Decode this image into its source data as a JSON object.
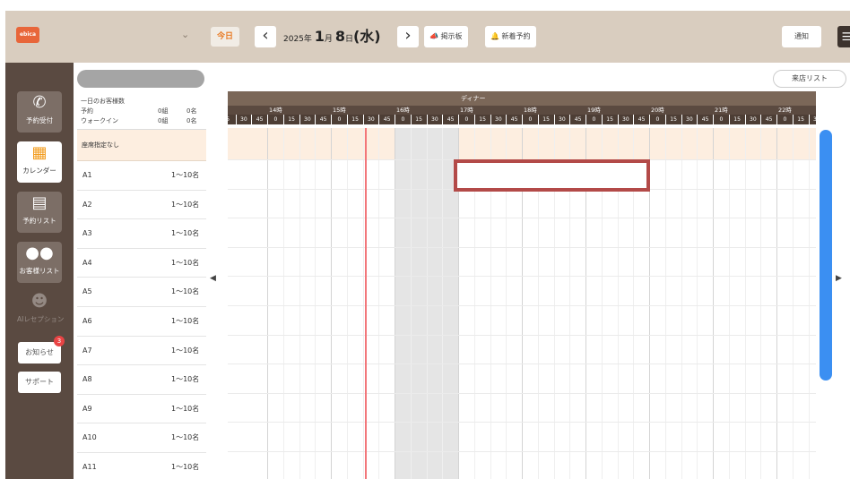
{
  "header": {
    "logo_text": "ebica",
    "today_label": "今日",
    "prev_icon": "chevron-left-icon",
    "next_icon": "chevron-right-icon",
    "date": {
      "year_label": "2025年",
      "month": "1",
      "month_unit": "月",
      "day": "8",
      "day_unit": "日",
      "weekday": "(水)"
    },
    "board_label": "掲示板",
    "new_reservation_label": "新着予約",
    "notify_label": "通知",
    "menu_icon": "hamburger-menu-icon"
  },
  "sidebar": {
    "items": [
      {
        "label": "予約受付",
        "icon": "phone-icon",
        "active": false
      },
      {
        "label": "カレンダー",
        "icon": "calendar-icon",
        "active": true
      },
      {
        "label": "予約リスト",
        "icon": "list-icon",
        "active": false
      },
      {
        "label": "お客様リスト",
        "icon": "users-icon",
        "active": false
      },
      {
        "label": "AIレセプション",
        "icon": "ai-reception-icon",
        "active": false
      }
    ],
    "notices_label": "お知らせ",
    "notices_badge": "3",
    "support_label": "サポート"
  },
  "summary": {
    "title": "一日のお客様数",
    "rows": [
      {
        "label": "予約",
        "groups": "0組",
        "people": "0名"
      },
      {
        "label": "ウォークイン",
        "groups": "0組",
        "people": "0名"
      }
    ]
  },
  "seat_none_label": "座席指定なし",
  "visit_list_label": "来店リスト",
  "tables": [
    {
      "name": "A1",
      "capacity": "1〜10名"
    },
    {
      "name": "A2",
      "capacity": "1〜10名"
    },
    {
      "name": "A3",
      "capacity": "1〜10名"
    },
    {
      "name": "A4",
      "capacity": "1〜10名"
    },
    {
      "name": "A5",
      "capacity": "1〜10名"
    },
    {
      "name": "A6",
      "capacity": "1〜10名"
    },
    {
      "name": "A7",
      "capacity": "1〜10名"
    },
    {
      "name": "A8",
      "capacity": "1〜10名"
    },
    {
      "name": "A9",
      "capacity": "1〜10名"
    },
    {
      "name": "A10",
      "capacity": "1〜10名"
    },
    {
      "name": "A11",
      "capacity": "1〜10名"
    }
  ],
  "timeline": {
    "period_label": "ディナー",
    "hours": [
      "14時",
      "15時",
      "16時",
      "17時",
      "18時",
      "19時",
      "20時",
      "21時",
      "22時"
    ],
    "minute_marks": [
      "0",
      "15",
      "30",
      "45"
    ],
    "leading_minutes": [
      "5",
      "30",
      "45"
    ],
    "trailing_minutes": [
      "0",
      "15",
      "3"
    ]
  },
  "colors": {
    "header_bg": "#d9cdbf",
    "sidebar_bg": "#5a4a41",
    "accent_orange": "#e87b25",
    "highlight_border": "#b34a48",
    "now_line": "#f2767a",
    "scrollbar": "#3b8ff2"
  }
}
